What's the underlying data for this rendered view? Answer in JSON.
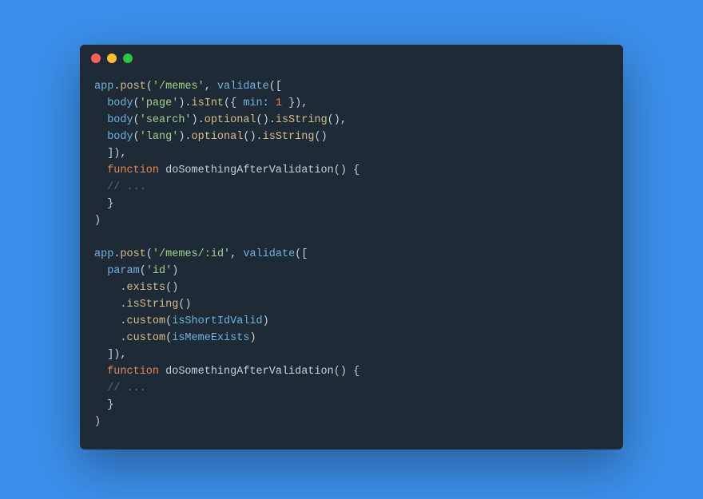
{
  "tokens": {
    "app": "app",
    "post": "post",
    "memes_path": "'/memes'",
    "memes_id_path": "'/memes/:id'",
    "validate": "validate",
    "body": "body",
    "param": "param",
    "page_str": "'page'",
    "search_str": "'search'",
    "lang_str": "'lang'",
    "id_str": "'id'",
    "isInt": "isInt",
    "optional": "optional",
    "isString": "isString",
    "exists": "exists",
    "custom": "custom",
    "min_key": "min",
    "min_val": "1",
    "function_kw": "function",
    "fn_name": "doSomethingAfterValidation",
    "isShortIdValid": "isShortIdValid",
    "isMemeExists": "isMemeExists",
    "comment": "// ..."
  }
}
